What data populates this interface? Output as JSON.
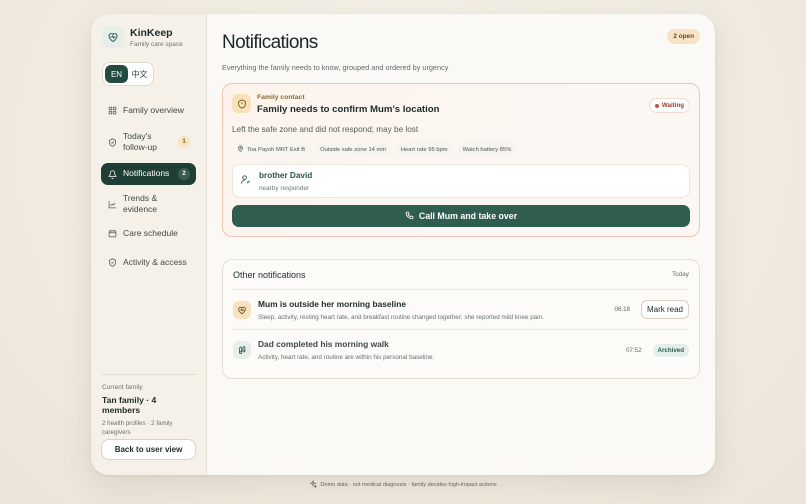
{
  "brand": {
    "name": "KinKeep",
    "subtitle": "Family care space",
    "logo_icon": "heart-shield-icon"
  },
  "language": {
    "options": [
      "EN",
      "中文"
    ],
    "selected": "EN"
  },
  "nav": {
    "items": [
      {
        "label": "Family overview",
        "icon": "grid-icon"
      },
      {
        "label": "Today's follow-up",
        "icon": "shield-check-icon",
        "badge": "1"
      },
      {
        "label": "Notifications",
        "icon": "bell-icon",
        "badge": "2",
        "active": true
      },
      {
        "label": "Trends & evidence",
        "icon": "trend-icon"
      },
      {
        "label": "Care schedule",
        "icon": "calendar-icon"
      },
      {
        "label": "Activity & access",
        "icon": "shield-icon"
      }
    ]
  },
  "family": {
    "caption": "Current family",
    "name": "Tan family · 4 members",
    "meta": "2 health profiles · 2 family caregivers"
  },
  "back_button": "Back to user view",
  "header": {
    "title": "Notifications",
    "subtitle": "Everything the family needs to know, grouped and ordered by urgency",
    "open_count": "2 open"
  },
  "urgent": {
    "category": "Family contact",
    "title": "Family needs to confirm Mum’s location",
    "status": "Waiting",
    "description": "Left the safe zone and did not respond; may be lost",
    "chips": [
      "Toa Payoh MRT Exit B",
      "Outside safe zone 14 min",
      "Heart rate 95 bpm",
      "Watch battery 85%"
    ],
    "responder": {
      "name": "brother David",
      "role": "nearby responder"
    },
    "action": "Call Mum and take over"
  },
  "others": {
    "title": "Other notifications",
    "date": "Today",
    "items": [
      {
        "title": "Mum is outside her morning baseline",
        "desc": "Sleep, activity, resting heart rate, and breakfast routine changed together; she reported mild knee pain.",
        "time": "06:18",
        "action": "Mark read"
      },
      {
        "title": "Dad completed his morning walk",
        "desc": "Activity, heart rate, and routine are within his personal baseline.",
        "time": "07:52",
        "status": "Archived"
      }
    ]
  },
  "footer": "Demo data · not medical diagnosis · family decides high-impact actions",
  "colors": {
    "accent": "#2f5e51",
    "nav_active": "#1f3f36",
    "warning": "#c4503a",
    "amber": "#f6e3c6"
  }
}
